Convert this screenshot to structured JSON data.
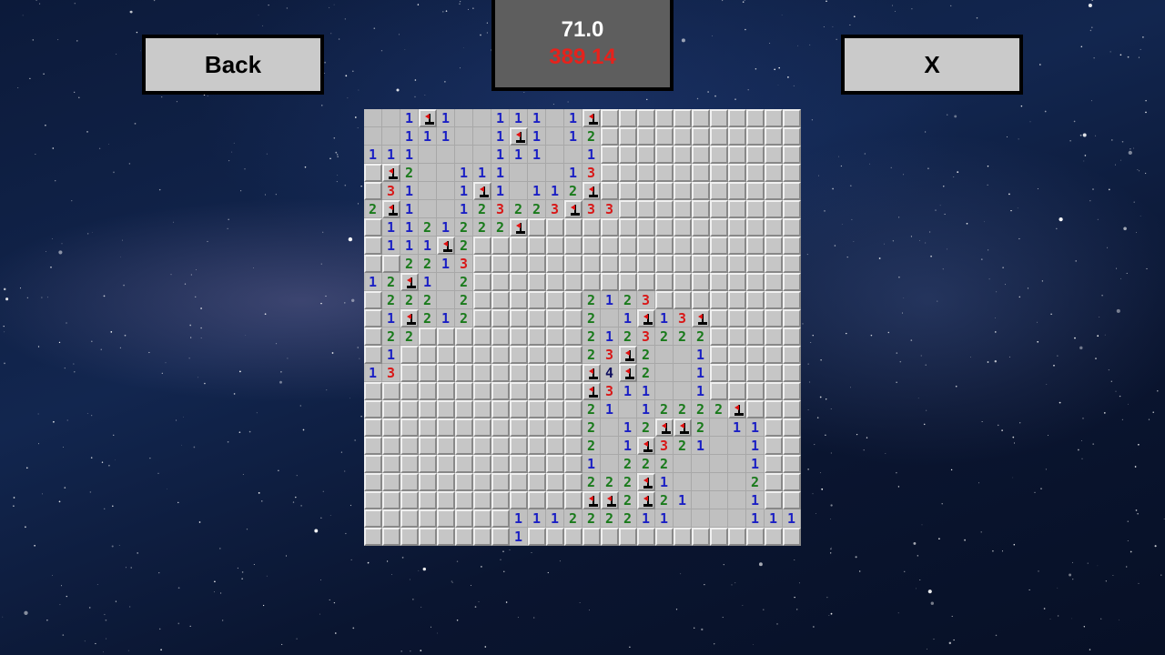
{
  "buttons": {
    "back_label": "Back",
    "close_label": "X"
  },
  "score": {
    "value": "71.0",
    "time": "389.14"
  },
  "board": {
    "cols": 24,
    "rows": 24,
    "legend": {
      ".": "unrevealed",
      " ": "empty",
      "F": "flag",
      "1": "one",
      "2": "two",
      "3": "three",
      "4": "four"
    },
    "grid": [
      "  1F1  111 1F...........",
      "  111  1F1 12...........",
      "111    111  1...........",
      ".F2  111   13...........",
      ".31  1F1 112F...........",
      "2F1  123223F33..........",
      ".1121222F...............",
      ".111F2..................",
      "..2213..................",
      "12F1 2..................",
      ".222 2......2123........",
      ".1F212......2 1F13F.....",
      ".22.........2123222.....",
      ".1..........23F2  1.....",
      "13..........F4F2  1.....",
      "............F311  1.....",
      "............21 12222F...",
      "............2 12FF2 11..",
      "............2 1F321  1..",
      "............1 222    1..",
      "............222F1    2..",
      "............FF2F21   1..",
      "........111222211    111",
      "........1..............."
    ]
  },
  "colors": {
    "number_1": "#1a1fc4",
    "number_2": "#197a1b",
    "number_3": "#d81818",
    "number_4": "#101060",
    "flag": "#e01010",
    "score_time": "#e6221c"
  }
}
